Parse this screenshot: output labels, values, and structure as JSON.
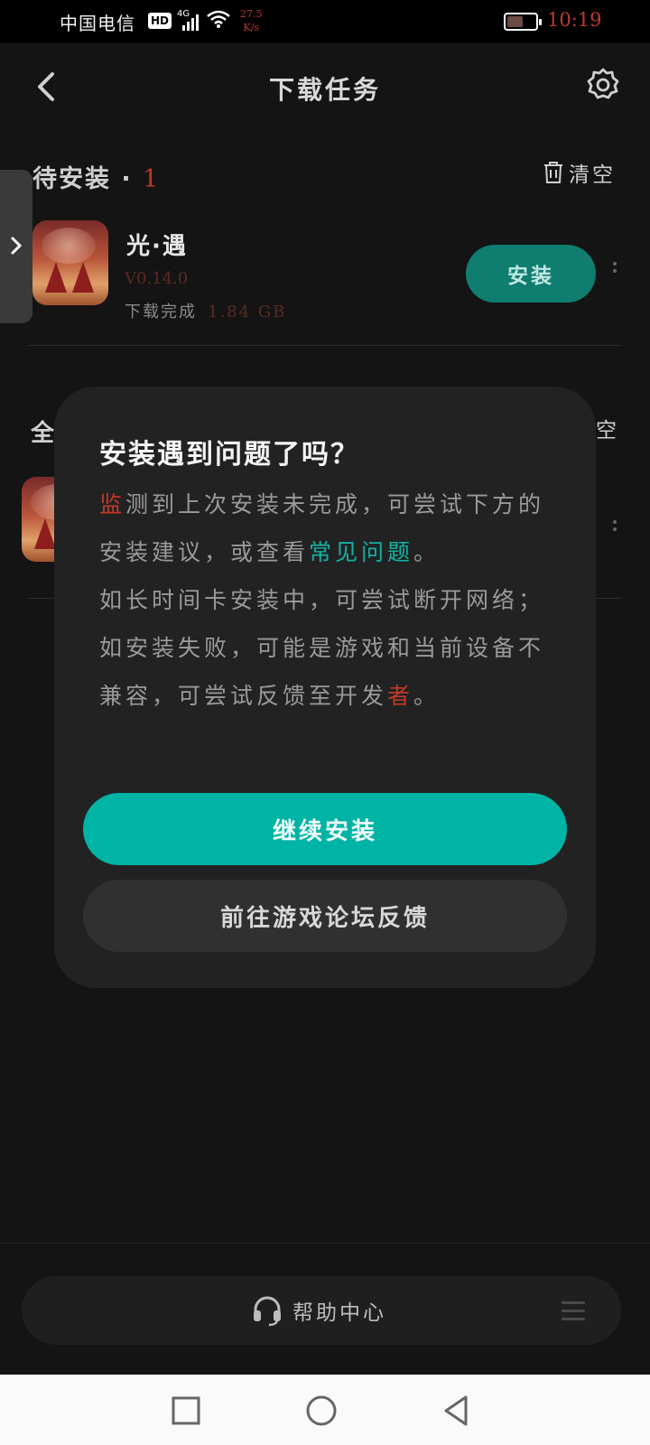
{
  "status_bar": {
    "carrier": "中国电信",
    "hd_badge": "HD",
    "network": "4G",
    "net_speed_value": "27.5",
    "net_speed_unit": "K/s",
    "battery_level": 0.55,
    "time": "10:19",
    "time_color": "#c0392b"
  },
  "header": {
    "title": "下载任务",
    "back_icon": "chevron-left-icon",
    "settings_icon": "gear-icon"
  },
  "pending_section": {
    "title": "待安装",
    "separator": "·",
    "count": "1",
    "clear_label": "清空",
    "clear_icon": "trash-icon"
  },
  "pending_item": {
    "name": "光·遇",
    "version": "V0.14.0",
    "status": "下载完成",
    "size": "1.84 GB",
    "install_label": "安装",
    "accent_color": "#0f7d70"
  },
  "section2_peek": {
    "title_char": "全",
    "clear_char": "空"
  },
  "dialog": {
    "title": "安装遇到问题了吗？",
    "para1_highlight": "监",
    "para1_text": "测到上次安装未完成，可尝试下方的安装建议，或查看",
    "para1_link": "常见问题",
    "para1_end": "。",
    "para2": "如长时间卡安装中，可尝试断开网络；",
    "para3_text": "如安装失败，可能是游戏和当前设备不兼容，可尝试反馈至开发",
    "para3_highlight": "者",
    "para3_end": "。",
    "continue_label": "继续安装",
    "feedback_label": "前往游戏论坛反馈",
    "primary_color": "#00b4a5"
  },
  "help_bar": {
    "label": "帮助中心",
    "icon": "headset-icon",
    "menu_icon": "menu-icon"
  },
  "nav_bar": {
    "recent_icon": "square-icon",
    "home_icon": "circle-icon",
    "back_icon": "triangle-back-icon"
  }
}
